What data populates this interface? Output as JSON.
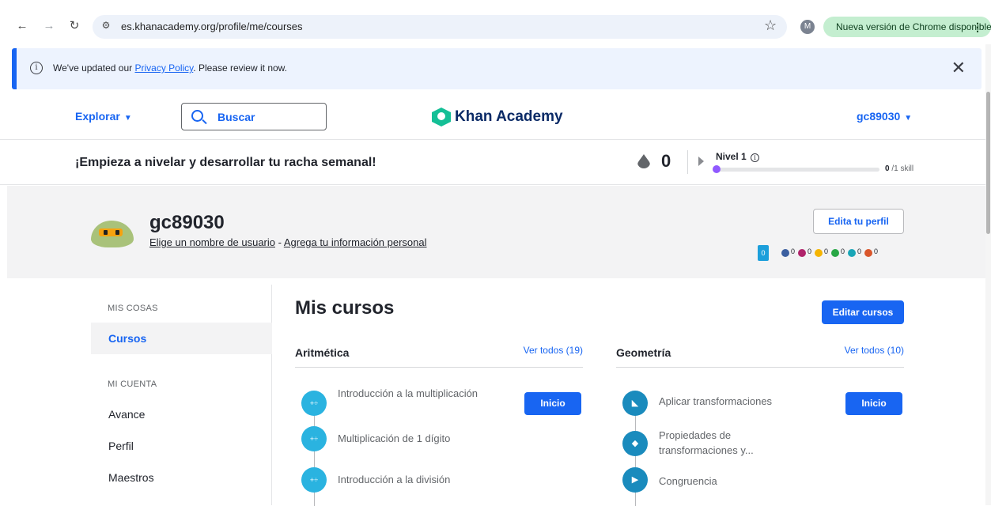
{
  "browser": {
    "url": "es.khanacademy.org/profile/me/courses",
    "profile_initial": "M",
    "update_label": "Nueva versión de Chrome disponible"
  },
  "banner": {
    "text_before": "We've updated our ",
    "link": "Privacy Policy",
    "text_after": ". Please review it now."
  },
  "header": {
    "explore": "Explorar",
    "search": "Buscar",
    "logo": "Khan Academy",
    "username": "gc89030"
  },
  "streak": {
    "message": "¡Empieza a nivelar y desarrollar tu racha semanal!",
    "count": "0",
    "level": "Nivel 1",
    "progress_fraction": 0,
    "skill_done": "0",
    "skill_total": "/1 skill"
  },
  "profile": {
    "username": "gc89030",
    "link_name": "Elige un nombre de usuario",
    "separator": " - ",
    "link_info": "Agrega tu información personal",
    "edit_button": "Edita tu perfil",
    "energy": "0",
    "badges": [
      {
        "color": "#3b5fa0",
        "count": "0"
      },
      {
        "color": "#b0246b",
        "count": "0"
      },
      {
        "color": "#f5b400",
        "count": "0"
      },
      {
        "color": "#28a745",
        "count": "0"
      },
      {
        "color": "#1aa6b7",
        "count": "0"
      },
      {
        "color": "#d9562b",
        "count": "0"
      }
    ]
  },
  "sidebar": {
    "section1": "MIS COSAS",
    "item_courses": "Cursos",
    "section2": "MI CUENTA",
    "item_progress": "Avance",
    "item_profile": "Perfil",
    "item_teachers": "Maestros"
  },
  "main": {
    "title": "Mis cursos",
    "edit_courses": "Editar cursos",
    "courses": [
      {
        "name": "Aritmética",
        "see_all": "Ver todos (19)",
        "start": "Inicio",
        "units": [
          "Introducción a la multiplicación",
          "Multiplicación de 1 dígito",
          "Introducción a la división"
        ]
      },
      {
        "name": "Geometría",
        "see_all": "Ver todos (10)",
        "start": "Inicio",
        "units": [
          "Aplicar transformaciones",
          "Propiedades de transformaciones y...",
          "Congruencia"
        ]
      }
    ]
  }
}
